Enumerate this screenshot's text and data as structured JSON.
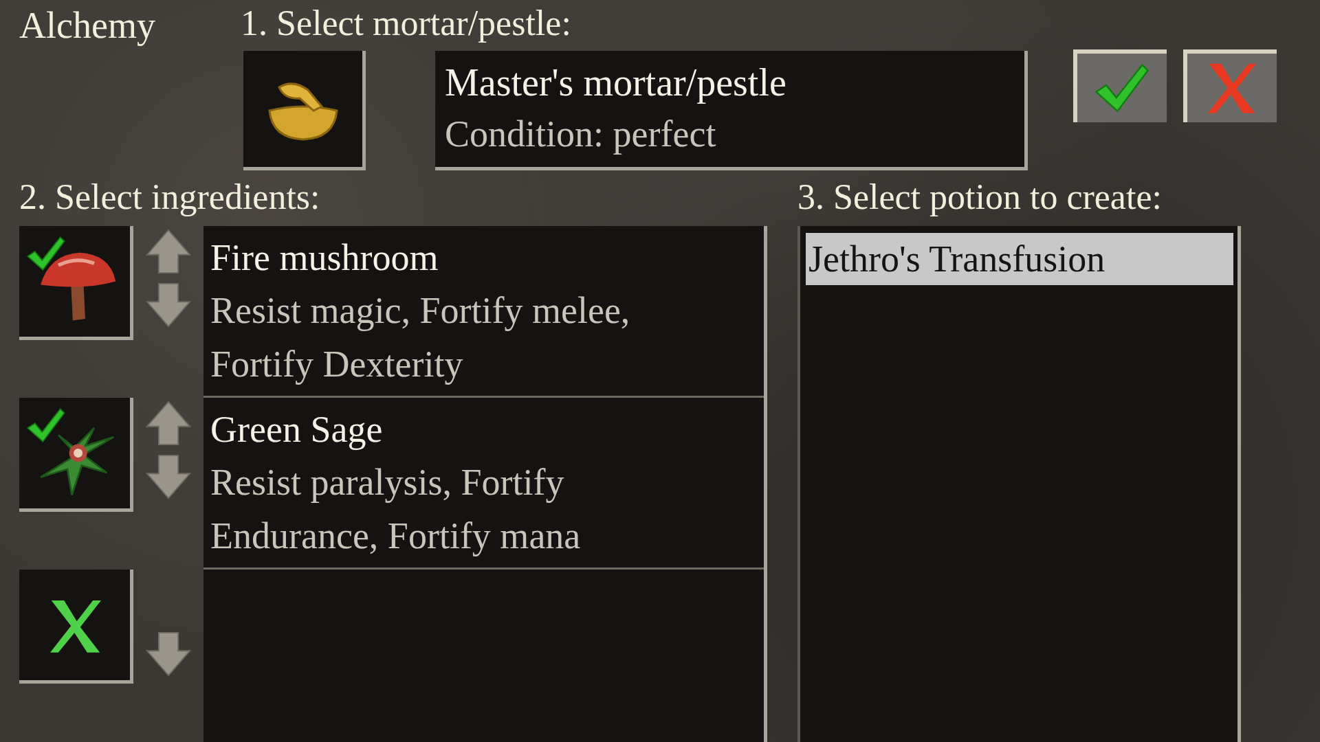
{
  "title": "Alchemy",
  "step_1": {
    "heading": "1. Select mortar/pestle:",
    "tool": {
      "name": "Master's mortar/pestle",
      "condition": "Condition: perfect"
    }
  },
  "buttons": [
    {
      "kind": "confirm"
    },
    {
      "kind": "cancel"
    }
  ],
  "step_2": {
    "heading": "2. Select ingredients:",
    "ingredients": [
      {
        "kind": "item",
        "name": "Fire mushroom",
        "effects": "Resist magic, Fortify melee, Fortify Dexterity",
        "checked": true
      },
      {
        "kind": "item",
        "name": "Green Sage",
        "effects": "Resist paralysis, Fortify Endurance, Fortify mana",
        "checked": true
      },
      {
        "kind": "empty"
      }
    ]
  },
  "step_3": {
    "heading": "3. Select potion to create:",
    "potions": [
      {
        "name": "Jethro's Transfusion",
        "selected": true
      }
    ]
  }
}
